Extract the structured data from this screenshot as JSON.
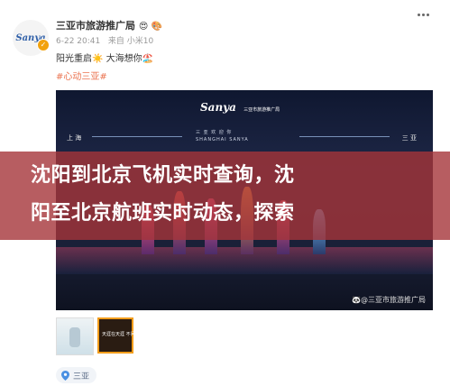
{
  "account": {
    "name": "三亚市旅游推广局",
    "name_emoji": "😍 🎨",
    "avatar_logo": "Sanya",
    "timestamp": "6-22 20:41",
    "source": "来自 小米10"
  },
  "post": {
    "text_line": "阳光重启☀️ 大海想你🏖️",
    "hashtag": "#心动三亚#"
  },
  "video": {
    "brand": "Sanya",
    "brand_sub": "三亚市旅游推广局",
    "title_cn": "三 亚 欢 迎 你",
    "title_en": "SHANGHAI SANYA",
    "left_city": "上 海",
    "right_city": "三 亚",
    "watermark": "🐼@三亚市旅游推广局"
  },
  "thumbnails": [
    {
      "label": ""
    },
    {
      "label": "天涯在天涯 不问"
    }
  ],
  "location": {
    "label": "三亚"
  },
  "overlay": {
    "line1": "沈阳到北京飞机实时查询，沈",
    "line2": "阳至北京航班实时动态，探索"
  },
  "colors": {
    "tag": "#eb7350",
    "overlay": "#a5343a",
    "verified": "#f2a20d"
  }
}
